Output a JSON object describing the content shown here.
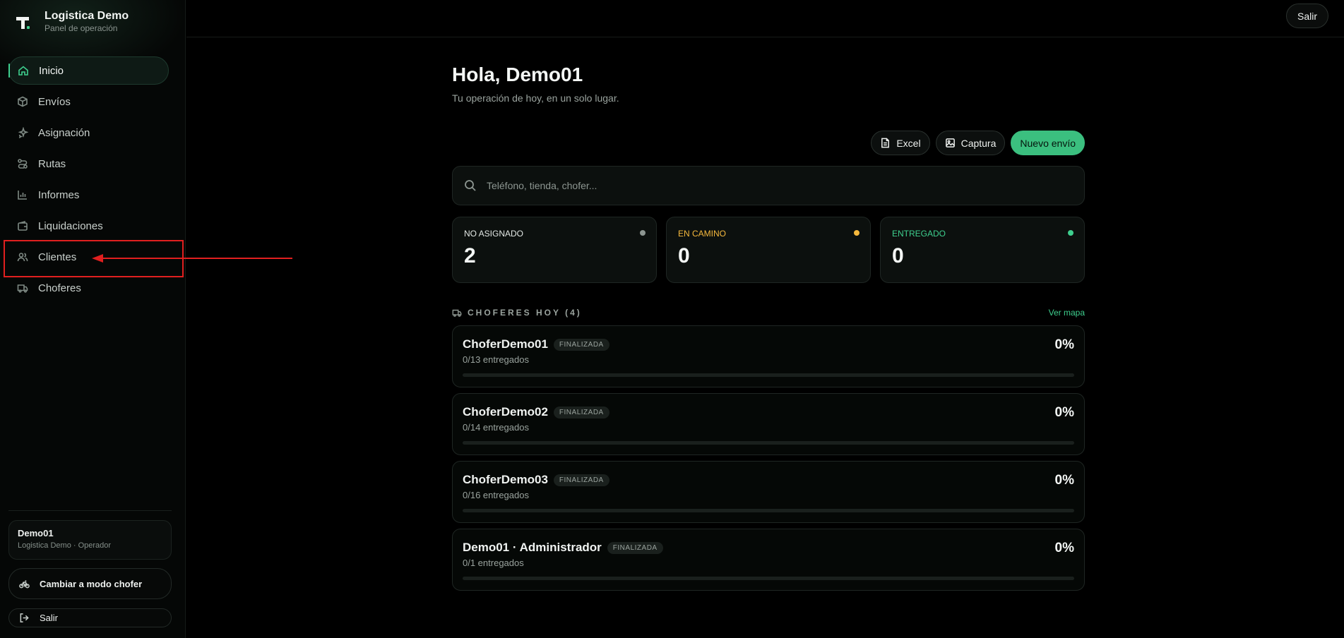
{
  "brand": {
    "name": "Logistica Demo",
    "subtitle": "Panel de operación"
  },
  "nav": [
    {
      "label": "Inicio",
      "icon": "home-icon",
      "active": true
    },
    {
      "label": "Envíos",
      "icon": "package-icon"
    },
    {
      "label": "Asignación",
      "icon": "sparkles-icon"
    },
    {
      "label": "Rutas",
      "icon": "route-icon"
    },
    {
      "label": "Informes",
      "icon": "bar-chart-icon"
    },
    {
      "label": "Liquidaciones",
      "icon": "wallet-icon"
    },
    {
      "label": "Clientes",
      "icon": "users-icon"
    },
    {
      "label": "Choferes",
      "icon": "truck-icon"
    }
  ],
  "user": {
    "name": "Demo01",
    "role": "Logistica Demo · Operador"
  },
  "sidebar_buttons": {
    "driver_mode": "Cambiar a modo chofer",
    "logout": "Salir"
  },
  "topbar": {
    "logout": "Salir"
  },
  "main": {
    "greeting": "Hola, Demo01",
    "subtitle": "Tu operación de hoy, en un solo lugar.",
    "actions": {
      "excel": "Excel",
      "capture": "Captura",
      "new": "Nuevo envío"
    },
    "search_placeholder": "Teléfono, tienda, chofer..."
  },
  "stats": [
    {
      "label": "NO ASIGNADO",
      "value": "2",
      "color": "#8d9691"
    },
    {
      "label": "EN CAMINO",
      "value": "0",
      "color": "#f5b83d"
    },
    {
      "label": "ENTREGADO",
      "value": "0",
      "color": "#3ecf8e"
    }
  ],
  "drivers": {
    "title": "CHOFERES HOY (4)",
    "map_link": "Ver mapa",
    "items": [
      {
        "name": "ChoferDemo01",
        "badge": "FINALIZADA",
        "count": "0/13 entregados",
        "percent": "0%",
        "progress": 0
      },
      {
        "name": "ChoferDemo02",
        "badge": "FINALIZADA",
        "count": "0/14 entregados",
        "percent": "0%",
        "progress": 0
      },
      {
        "name": "ChoferDemo03",
        "badge": "FINALIZADA",
        "count": "0/16 entregados",
        "percent": "0%",
        "progress": 0
      },
      {
        "name": "Demo01 · Administrador",
        "badge": "FINALIZADA",
        "count": "0/1 entregados",
        "percent": "0%",
        "progress": 0
      }
    ]
  },
  "colors": {
    "accent": "#3ecf8e",
    "highlight": "#e01f1f"
  }
}
